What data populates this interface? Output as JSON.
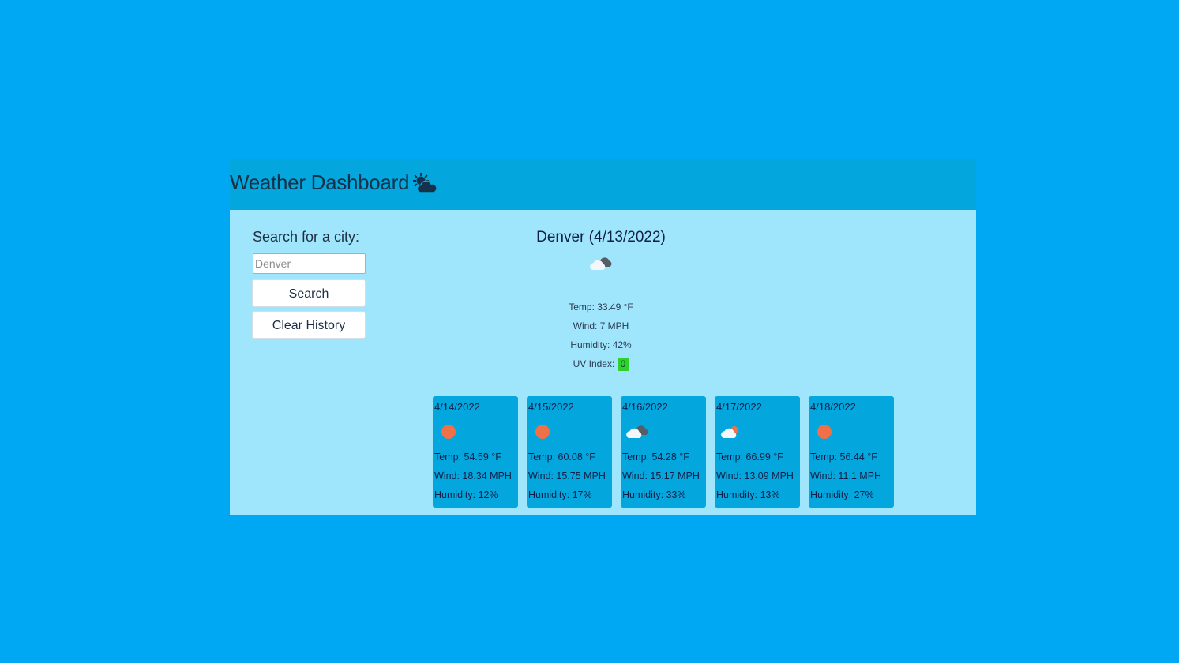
{
  "header": {
    "title": "Weather Dashboard",
    "icon": "sun-behind-cloud-icon"
  },
  "sidebar": {
    "search_label": "Search for a city:",
    "search_input": {
      "value": "",
      "placeholder": "Denver"
    },
    "search_button": "Search",
    "clear_button": "Clear History"
  },
  "current": {
    "title": "Denver (4/13/2022)",
    "icon": "broken-clouds-icon",
    "temp": "Temp: 33.49 °F",
    "wind": "Wind: 7 MPH",
    "humidity": "Humidity: 42%",
    "uv_label": "UV Index:",
    "uv_value": "0",
    "uv_color": "#2ed12e"
  },
  "forecast": [
    {
      "date": "4/14/2022",
      "icon": "clear-sun-icon",
      "temp": "Temp: 54.59 °F",
      "wind": "Wind: 18.34 MPH",
      "humidity": "Humidity: 12%"
    },
    {
      "date": "4/15/2022",
      "icon": "clear-sun-icon",
      "temp": "Temp: 60.08 °F",
      "wind": "Wind: 15.75 MPH",
      "humidity": "Humidity: 17%"
    },
    {
      "date": "4/16/2022",
      "icon": "broken-clouds-icon",
      "temp": "Temp: 54.28 °F",
      "wind": "Wind: 15.17 MPH",
      "humidity": "Humidity: 33%"
    },
    {
      "date": "4/17/2022",
      "icon": "few-clouds-icon",
      "temp": "Temp: 66.99 °F",
      "wind": "Wind: 13.09 MPH",
      "humidity": "Humidity: 13%"
    },
    {
      "date": "4/18/2022",
      "icon": "clear-sun-icon",
      "temp": "Temp: 56.44 °F",
      "wind": "Wind: 11.1 MPH",
      "humidity": "Humidity: 27%"
    }
  ],
  "colors": {
    "page_background": "#00a8f3",
    "header_background": "#03a7dd",
    "panel_background": "#9fe5fb",
    "card_background": "#03a7dd",
    "sun": "#ef7049"
  }
}
